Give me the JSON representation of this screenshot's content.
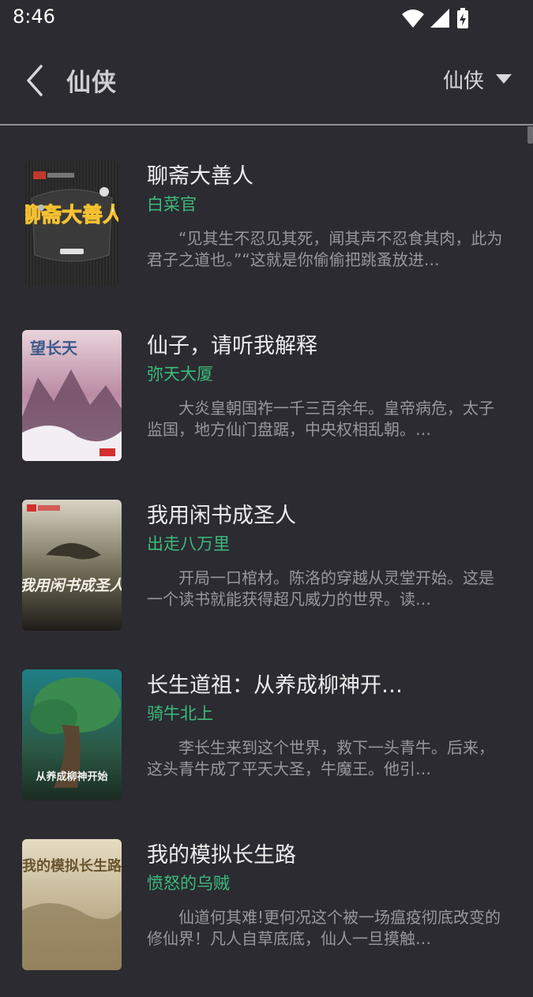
{
  "status_bar": {
    "time": "8:46",
    "icons": [
      "wifi-icon",
      "signal-icon",
      "battery-charging-icon"
    ]
  },
  "header": {
    "title": "仙侠",
    "filter": {
      "selected": "仙侠",
      "icon": "caret-down-icon"
    },
    "back_icon": "chevron-left-icon"
  },
  "colors": {
    "background": "#2b2b31",
    "author": "#3bbb7c",
    "description": "#97979c"
  },
  "books": [
    {
      "title": "聊斋大善人",
      "author": "白菜官",
      "description": "“见其生不忍见其死，闻其声不忍食其肉，此为君子之道也。”“这就是你偷偷把跳蚤放进…",
      "cover_text": "聊斋大善人"
    },
    {
      "title": "仙子，请听我解释",
      "author": "弥天大厦",
      "description": "大炎皇朝国祚一千三百余年。皇帝病危，太子监国，地方仙门盘踞，中央权相乱朝。…",
      "cover_text": "望长天"
    },
    {
      "title": "我用闲书成圣人",
      "author": "出走八万里",
      "description": "开局一口棺材。陈洛的穿越从灵堂开始。这是一个读书就能获得超凡威力的世界。读…",
      "cover_text": "我用闲书成圣人"
    },
    {
      "title": "长生道祖：从养成柳神开…",
      "author": "骑牛北上",
      "description": "李长生来到这个世界，救下一头青牛。后来，这头青牛成了平天大圣，牛魔王。他引…",
      "cover_text": "从养成柳神开始"
    },
    {
      "title": "我的模拟长生路",
      "author": "愤怒的乌贼",
      "description": "仙道何其难!更何况这个被一场瘟疫彻底改变的修仙界！凡人自草底底，仙人一旦摸触…",
      "cover_text": "我的模拟长生路"
    }
  ]
}
